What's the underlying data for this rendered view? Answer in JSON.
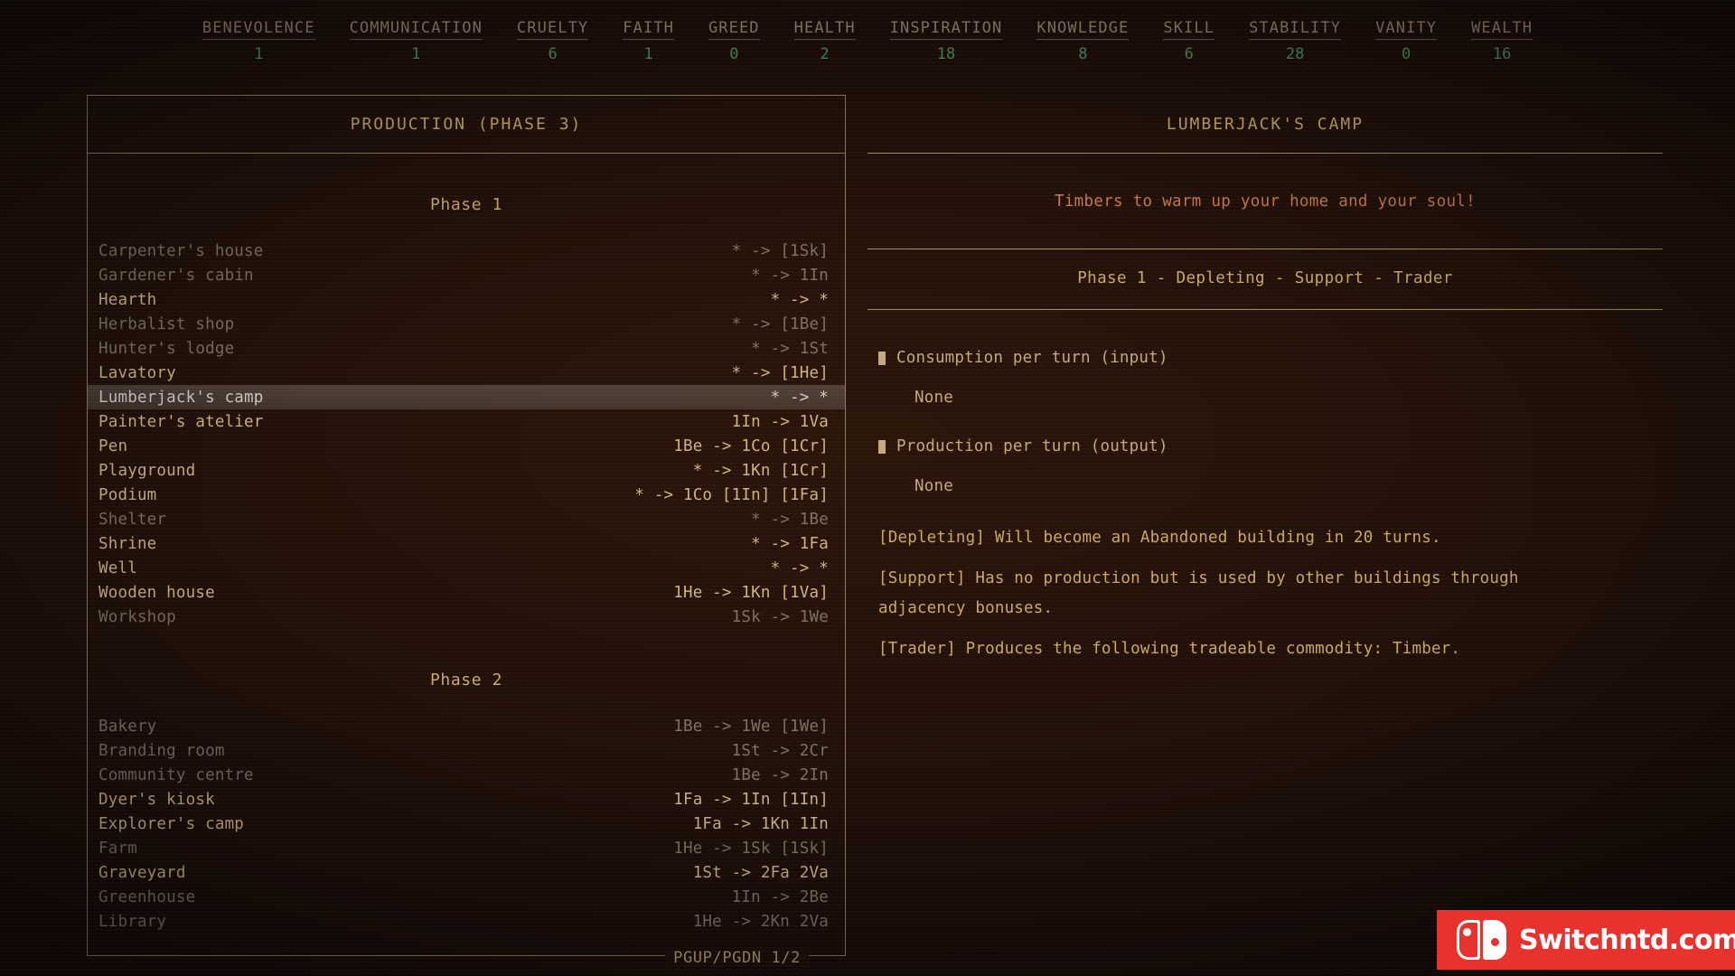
{
  "stats": [
    {
      "name": "BENEVOLENCE",
      "value": "1"
    },
    {
      "name": "COMMUNICATION",
      "value": "1"
    },
    {
      "name": "CRUELTY",
      "value": "6"
    },
    {
      "name": "FAITH",
      "value": "1"
    },
    {
      "name": "GREED",
      "value": "0"
    },
    {
      "name": "HEALTH",
      "value": "2"
    },
    {
      "name": "INSPIRATION",
      "value": "18"
    },
    {
      "name": "KNOWLEDGE",
      "value": "8"
    },
    {
      "name": "SKILL",
      "value": "6"
    },
    {
      "name": "STABILITY",
      "value": "28"
    },
    {
      "name": "VANITY",
      "value": "0"
    },
    {
      "name": "WEALTH",
      "value": "16"
    }
  ],
  "left_panel": {
    "title": "PRODUCTION (PHASE 3)",
    "phase1_label": "Phase 1",
    "phase2_label": "Phase 2",
    "page_label": "PGUP/PGDN 1/2",
    "phase1_rows": [
      {
        "name": "Carpenter's house",
        "recipe": "* -> [1Sk]",
        "state": "dim"
      },
      {
        "name": "Gardener's cabin",
        "recipe": "* -> 1In",
        "state": "dim"
      },
      {
        "name": "Hearth",
        "recipe": "* -> *",
        "state": "bright"
      },
      {
        "name": "Herbalist shop",
        "recipe": "* -> [1Be]",
        "state": "dim"
      },
      {
        "name": "Hunter's lodge",
        "recipe": "* -> 1St",
        "state": "dim"
      },
      {
        "name": "Lavatory",
        "recipe": "* -> [1He]",
        "state": "bright"
      },
      {
        "name": "Lumberjack's camp",
        "recipe": "* -> *",
        "state": "selected"
      },
      {
        "name": "Painter's atelier",
        "recipe": "1In -> 1Va",
        "state": "bright"
      },
      {
        "name": "Pen",
        "recipe": "1Be -> 1Co [1Cr]",
        "state": "bright"
      },
      {
        "name": "Playground",
        "recipe": "* -> 1Kn [1Cr]",
        "state": "bright"
      },
      {
        "name": "Podium",
        "recipe": "* -> 1Co [1In] [1Fa]",
        "state": "bright"
      },
      {
        "name": "Shelter",
        "recipe": "* -> 1Be",
        "state": "dim"
      },
      {
        "name": "Shrine",
        "recipe": "* -> 1Fa",
        "state": "bright"
      },
      {
        "name": "Well",
        "recipe": "* -> *",
        "state": "bright"
      },
      {
        "name": "Wooden house",
        "recipe": "1He -> 1Kn [1Va]",
        "state": "bright"
      },
      {
        "name": "Workshop",
        "recipe": "1Sk -> 1We",
        "state": "dim"
      }
    ],
    "phase2_rows": [
      {
        "name": "Bakery",
        "recipe": "1Be -> 1We [1We]",
        "state": "dim"
      },
      {
        "name": "Branding room",
        "recipe": "1St -> 2Cr",
        "state": "dim"
      },
      {
        "name": "Community centre",
        "recipe": "1Be -> 2In",
        "state": "dim"
      },
      {
        "name": "Dyer's kiosk",
        "recipe": "1Fa -> 1In [1In]",
        "state": "bright"
      },
      {
        "name": "Explorer's camp",
        "recipe": "1Fa -> 1Kn 1In",
        "state": "bright"
      },
      {
        "name": "Farm",
        "recipe": "1He -> 1Sk [1Sk]",
        "state": "dim"
      },
      {
        "name": "Graveyard",
        "recipe": "1St -> 2Fa 2Va",
        "state": "bright"
      },
      {
        "name": "Greenhouse",
        "recipe": "1In -> 2Be",
        "state": "dim"
      },
      {
        "name": "Library",
        "recipe": "1He -> 2Kn 2Va",
        "state": "dim"
      }
    ]
  },
  "right_panel": {
    "title": "LUMBERJACK'S CAMP",
    "tagline": "Timbers to warm up your home and your soul!",
    "phase_tags": "Phase 1 - Depleting - Support - Trader",
    "consumption_label": "Consumption per turn (input)",
    "consumption_value": "None",
    "production_label": "Production per turn (output)",
    "production_value": "None",
    "paragraphs": [
      "[Depleting] Will become an Abandoned building in 20 turns.",
      "[Support] Has no production but is used by other buildings through adjacency bonuses.",
      "[Trader] Produces the following tradeable commodity: Timber."
    ]
  },
  "watermark": {
    "text": "Switchntd.com"
  },
  "colors": {
    "accent_gold": "#c8a964",
    "stat_value_green": "#4e9460",
    "tagline_orange": "#c8794f",
    "border": "#8d7a61",
    "watermark_red": "#e8322e"
  }
}
